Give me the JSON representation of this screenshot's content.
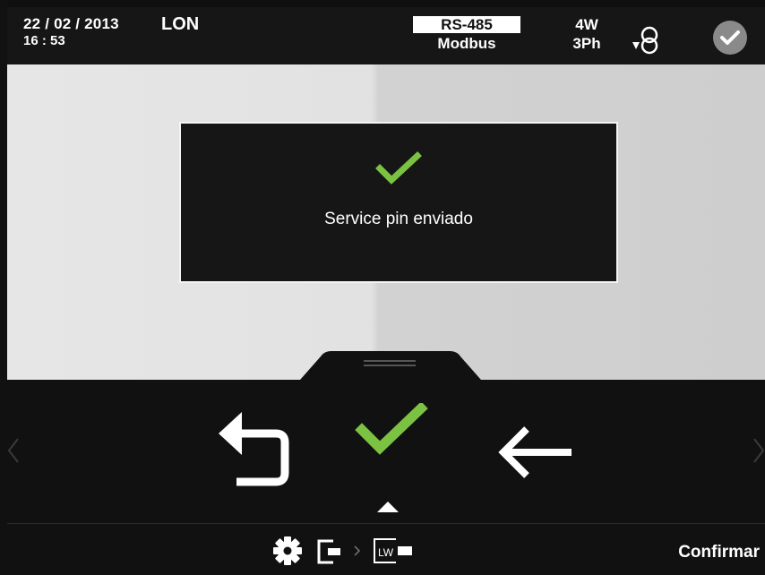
{
  "header": {
    "date": "22 / 02 / 2013",
    "time": "16 : 53",
    "location": "LON",
    "protocol": "RS-485",
    "bus": "Modbus",
    "wiring": "4W",
    "phase": "3Ph",
    "icons": [
      "transformer-icon",
      "status-ok-icon"
    ]
  },
  "dialog": {
    "message": "Service pin enviado",
    "icon": "checkmark-icon",
    "accent": "#7cc242"
  },
  "controls": {
    "back_icon": "back-arrow-icon",
    "confirm_icon": "checkmark-icon",
    "left_icon": "left-arrow-icon",
    "up_icon": "up-triangle-icon"
  },
  "footer": {
    "confirm_label": "Confirmar",
    "icons": [
      "settings-icon",
      "exit-icon",
      "lw-icon"
    ]
  }
}
